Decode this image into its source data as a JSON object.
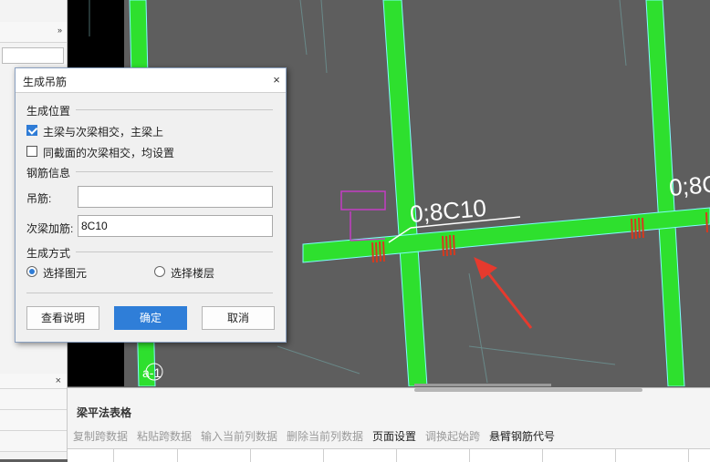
{
  "left_panel": {
    "expand_arrow": "»",
    "close_glyph": "×"
  },
  "dialog": {
    "title": "生成吊筋",
    "close_glyph": "×",
    "section_position": "生成位置",
    "opt_main_secondary": {
      "label": "主梁与次梁相交，主梁上",
      "checked": true
    },
    "opt_same_section": {
      "label": "同截面的次梁相交，均设置",
      "checked": false
    },
    "section_rebar": "钢筋信息",
    "hanger_label": "吊筋:",
    "hanger_value": "",
    "extra_stirrup_label": "次梁加筋:",
    "extra_stirrup_value": "8C10",
    "section_method": "生成方式",
    "radio_element": {
      "label": "选择图元",
      "selected": true
    },
    "radio_floor": {
      "label": "选择楼层",
      "selected": false
    },
    "btn_help": "查看说明",
    "btn_ok": "确定",
    "btn_cancel": "取消"
  },
  "canvas": {
    "annotation_main": "0;8C10",
    "annotation_right": "0;8C",
    "beam_color": "#2ee02e",
    "arrow_color": "#e63a2e",
    "label_a1": "a-1"
  },
  "bottom_panel": {
    "title": "梁平法表格",
    "toolbar": [
      {
        "label": "复制跨数据",
        "enabled": false
      },
      {
        "label": "粘贴跨数据",
        "enabled": false
      },
      {
        "label": "输入当前列数据",
        "enabled": false
      },
      {
        "label": "删除当前列数据",
        "enabled": false
      },
      {
        "label": "页面设置",
        "enabled": true
      },
      {
        "label": "调换起始跨",
        "enabled": false
      },
      {
        "label": "悬臂钢筋代号",
        "enabled": true
      }
    ]
  }
}
